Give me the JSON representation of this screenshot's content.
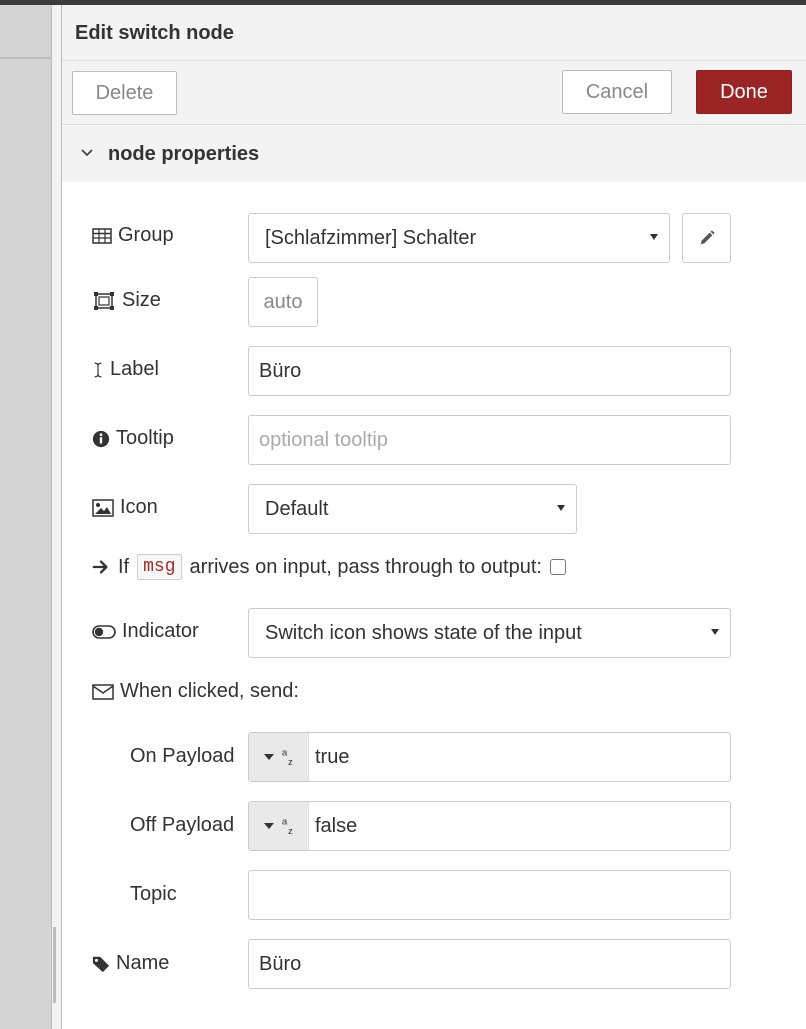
{
  "window": {
    "title": "Edit switch node"
  },
  "toolbar": {
    "delete_label": "Delete",
    "cancel_label": "Cancel",
    "done_label": "Done"
  },
  "section": {
    "title": "node properties"
  },
  "fields": {
    "group": {
      "label": "Group",
      "value": "[Schlafzimmer] Schalter"
    },
    "size": {
      "label": "Size",
      "value": "auto"
    },
    "label": {
      "label": "Label",
      "value": "Büro"
    },
    "tooltip": {
      "label": "Tooltip",
      "placeholder": "optional tooltip"
    },
    "icon": {
      "label": "Icon",
      "value": "Default"
    },
    "passthrough": {
      "prefix": "If",
      "code": "msg",
      "suffix": "arrives on input, pass through to output:",
      "checked": false
    },
    "indicator": {
      "label": "Indicator",
      "value": "Switch icon shows state of the input"
    },
    "when_clicked": {
      "label": "When clicked, send:"
    },
    "on_payload": {
      "label": "On Payload",
      "value": "true"
    },
    "off_payload": {
      "label": "Off Payload",
      "value": "false"
    },
    "topic": {
      "label": "Topic",
      "value": ""
    },
    "name": {
      "label": "Name",
      "value": "Büro"
    }
  },
  "colors": {
    "primary": "#9b2424",
    "panel_bg": "#f3f3f3",
    "code_text": "#a52a2a"
  }
}
